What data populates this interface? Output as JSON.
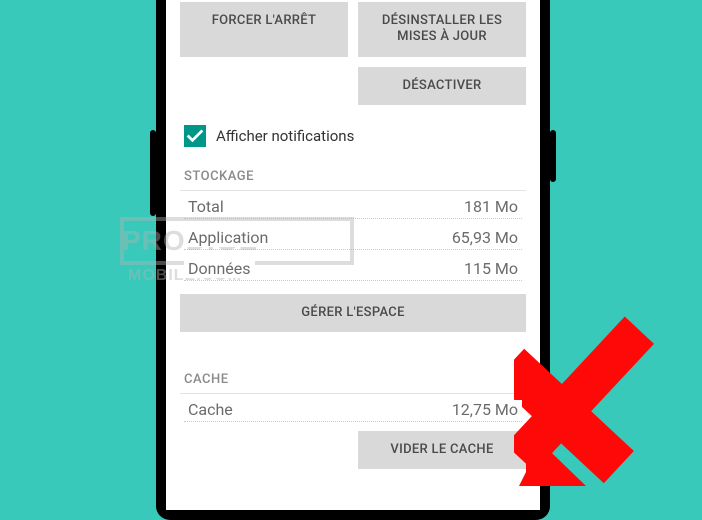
{
  "buttons": {
    "force_stop": "FORCER L'ARRÊT",
    "uninstall_updates": "DÉSINSTALLER LES MISES À JOUR",
    "disable": "DÉSACTIVER",
    "manage_space": "GÉRER L'ESPACE",
    "clear_cache": "VIDER LE CACHE"
  },
  "notifications": {
    "label": "Afficher notifications",
    "checked": true
  },
  "sections": {
    "storage_title": "STOCKAGE",
    "cache_title": "CACHE"
  },
  "storage": {
    "total_label": "Total",
    "total_value": "181 Mo",
    "app_label": "Application",
    "app_value": "65,93 Mo",
    "data_label": "Données",
    "data_value": "115 Mo"
  },
  "cache": {
    "label": "Cache",
    "value": "12,75 Mo"
  },
  "watermark": {
    "line1": "PRODIGE",
    "line2": "MOBILE.COM"
  }
}
